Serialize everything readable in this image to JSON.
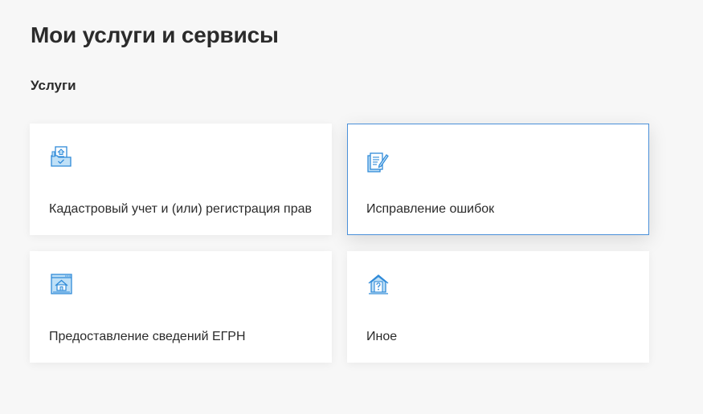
{
  "page": {
    "title": "Мои услуги и сервисы",
    "section_title": "Услуги"
  },
  "cards": [
    {
      "label": "Кадастровый учет и (или) регистрация прав",
      "icon": "folder-document-icon",
      "active": false
    },
    {
      "label": "Исправление ошибок",
      "icon": "document-edit-icon",
      "active": true
    },
    {
      "label": "Предоставление сведений ЕГРН",
      "icon": "window-house-icon",
      "active": false
    },
    {
      "label": "Иное",
      "icon": "house-question-icon",
      "active": false
    }
  ],
  "colors": {
    "background": "#f7f7f7",
    "card": "#ffffff",
    "accent": "#4a90d9",
    "icon_fill": "#bfe0f7",
    "icon_stroke": "#2f8ad8",
    "text": "#2b2b2b"
  }
}
